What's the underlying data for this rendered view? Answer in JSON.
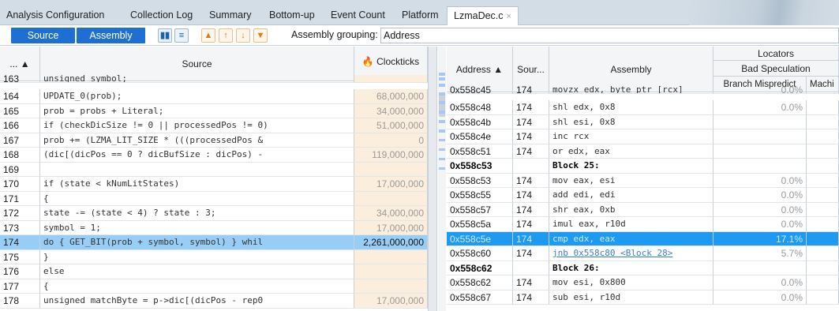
{
  "tabs": [
    {
      "label": "Analysis Configuration"
    },
    {
      "label": "Collection Log"
    },
    {
      "label": "Summary"
    },
    {
      "label": "Bottom-up"
    },
    {
      "label": "Event Count"
    },
    {
      "label": "Platform"
    },
    {
      "label": "LzmaDec.c",
      "close": "×"
    }
  ],
  "toolbar": {
    "source_label": "Source",
    "assembly_label": "Assembly",
    "grouping_label": "Assembly grouping:",
    "grouping_value": "Address"
  },
  "source_pane": {
    "headers": {
      "line": "... ▲",
      "source": "Source",
      "clockticks": "Clockticks"
    },
    "rows": [
      {
        "line": "163",
        "code": "    unsigned symbol;",
        "ticks": ""
      },
      {
        "line": "164",
        "code": "    UPDATE_0(prob);",
        "ticks": "68,000,000"
      },
      {
        "line": "165",
        "code": "    prob = probs + Literal;",
        "ticks": "34,000,000"
      },
      {
        "line": "166",
        "code": "    if (checkDicSize != 0 || processedPos != 0)",
        "ticks": "51,000,000"
      },
      {
        "line": "167",
        "code": "      prob += (LZMA_LIT_SIZE * (((processedPos &",
        "ticks": "0"
      },
      {
        "line": "168",
        "code": "      (dic[(dicPos == 0 ? dicBufSize : dicPos) -",
        "ticks": "119,000,000"
      },
      {
        "line": "169",
        "code": "",
        "ticks": ""
      },
      {
        "line": "170",
        "code": "    if (state < kNumLitStates)",
        "ticks": "17,000,000"
      },
      {
        "line": "171",
        "code": "    {",
        "ticks": ""
      },
      {
        "line": "172",
        "code": "      state -= (state < 4) ? state : 3;",
        "ticks": "34,000,000"
      },
      {
        "line": "173",
        "code": "      symbol = 1;",
        "ticks": "17,000,000"
      },
      {
        "line": "174",
        "code": "      do { GET_BIT(prob + symbol, symbol) } whil",
        "ticks": "2,261,000,000",
        "selected": true
      },
      {
        "line": "175",
        "code": "    }",
        "ticks": ""
      },
      {
        "line": "176",
        "code": "    else",
        "ticks": ""
      },
      {
        "line": "177",
        "code": "    {",
        "ticks": ""
      },
      {
        "line": "178",
        "code": "      unsigned matchByte = p->dic[(dicPos - rep0",
        "ticks": "17,000,000"
      }
    ]
  },
  "asm_pane": {
    "headers": {
      "address": "Address ▲",
      "source": "Sour...",
      "assembly": "Assembly",
      "locators": "Locators",
      "bad_spec": "Bad Speculation",
      "branch_mispredict": "Branch Mispredict",
      "machine": "Machi"
    },
    "rows": [
      {
        "addr": "0x558c45",
        "src": "174",
        "asm": "movzx edx, byte ptr [rcx]",
        "bm": "0.0%"
      },
      {
        "addr": "0x558c48",
        "src": "174",
        "asm": "shl edx, 0x8",
        "bm": "0.0%"
      },
      {
        "addr": "0x558c4b",
        "src": "174",
        "asm": "shl esi, 0x8",
        "bm": ""
      },
      {
        "addr": "0x558c4e",
        "src": "174",
        "asm": "inc rcx",
        "bm": ""
      },
      {
        "addr": "0x558c51",
        "src": "174",
        "asm": "or edx, eax",
        "bm": ""
      },
      {
        "addr": "0x558c53",
        "src": "",
        "asm": "Block 25:",
        "bm": "",
        "block": true
      },
      {
        "addr": "0x558c53",
        "src": "174",
        "asm": "mov eax, esi",
        "bm": "0.0%"
      },
      {
        "addr": "0x558c55",
        "src": "174",
        "asm": "add edi, edi",
        "bm": "0.0%"
      },
      {
        "addr": "0x558c57",
        "src": "174",
        "asm": "shr eax, 0xb",
        "bm": "0.0%"
      },
      {
        "addr": "0x558c5a",
        "src": "174",
        "asm": "imul eax, r10d",
        "bm": "0.0%"
      },
      {
        "addr": "0x558c5e",
        "src": "174",
        "asm": "cmp edx, eax",
        "bm": "17.1%",
        "selected": true
      },
      {
        "addr": "0x558c60",
        "src": "174",
        "asm": "jnb 0x558c80 <Block 28>",
        "bm": "5.7%",
        "link": true
      },
      {
        "addr": "0x558c62",
        "src": "",
        "asm": "Block 26:",
        "bm": "",
        "block": true
      },
      {
        "addr": "0x558c62",
        "src": "174",
        "asm": "mov esi, 0x800",
        "bm": "0.0%"
      },
      {
        "addr": "0x558c67",
        "src": "174",
        "asm": "sub esi, r10d",
        "bm": "0.0%"
      }
    ]
  }
}
